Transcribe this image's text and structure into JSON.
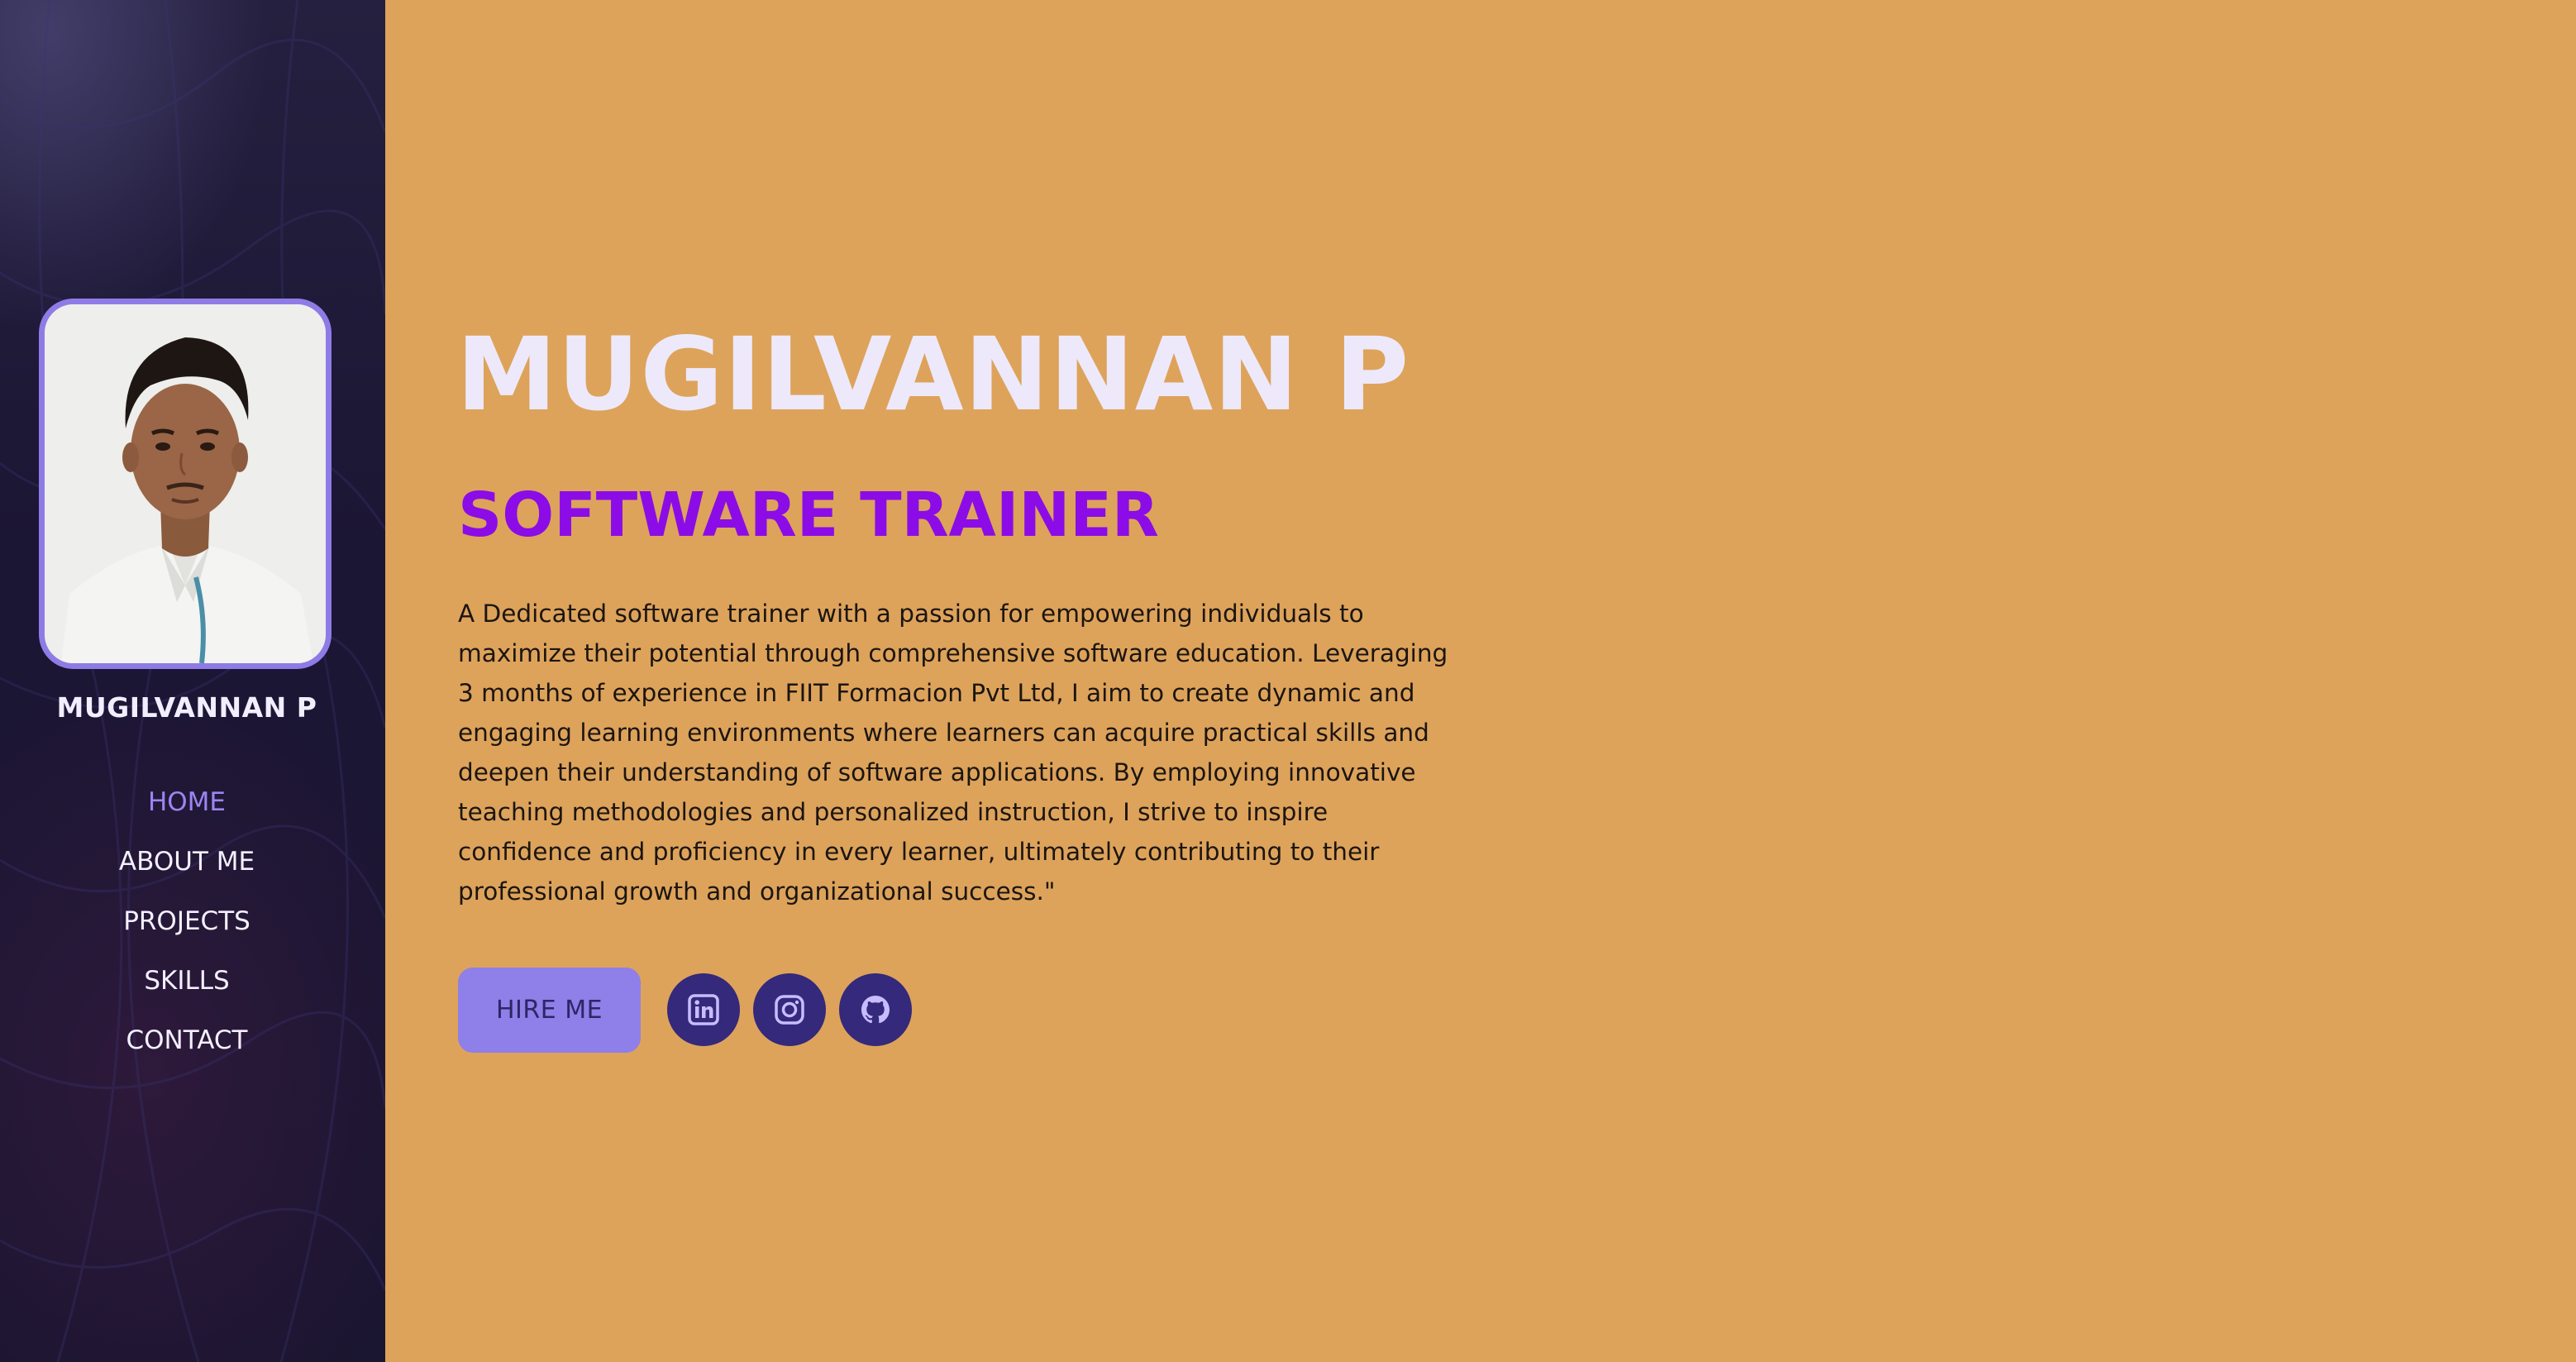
{
  "sidebar": {
    "name": "MUGILVANNAN P",
    "nav": [
      {
        "label": "HOME",
        "active": true
      },
      {
        "label": "ABOUT ME",
        "active": false
      },
      {
        "label": "PROJECTS",
        "active": false
      },
      {
        "label": "SKILLS",
        "active": false
      },
      {
        "label": "CONTACT",
        "active": false
      }
    ]
  },
  "hero": {
    "name": "MUGILVANNAN P",
    "role": "SOFTWARE TRAINER",
    "description": "A Dedicated software trainer with a passion for empowering individuals to maximize their potential through comprehensive software education. Leveraging 3 months of experience in FIIT Formacion Pvt Ltd, I aim to create dynamic and engaging learning environments where learners can acquire practical skills and deepen their understanding of software applications. By employing innovative teaching methodologies and personalized instruction, I strive to inspire confidence and proficiency in every learner, ultimately contributing to their professional growth and organizational success.\"",
    "hire_label": "HIRE ME",
    "socials": [
      "linkedin-icon",
      "instagram-icon",
      "github-icon"
    ]
  },
  "colors": {
    "background": "#dda35b",
    "sidebar": "#1b1634",
    "accent": "#8f7be6",
    "role": "#8b0ce6",
    "social_bg": "#34297a"
  }
}
